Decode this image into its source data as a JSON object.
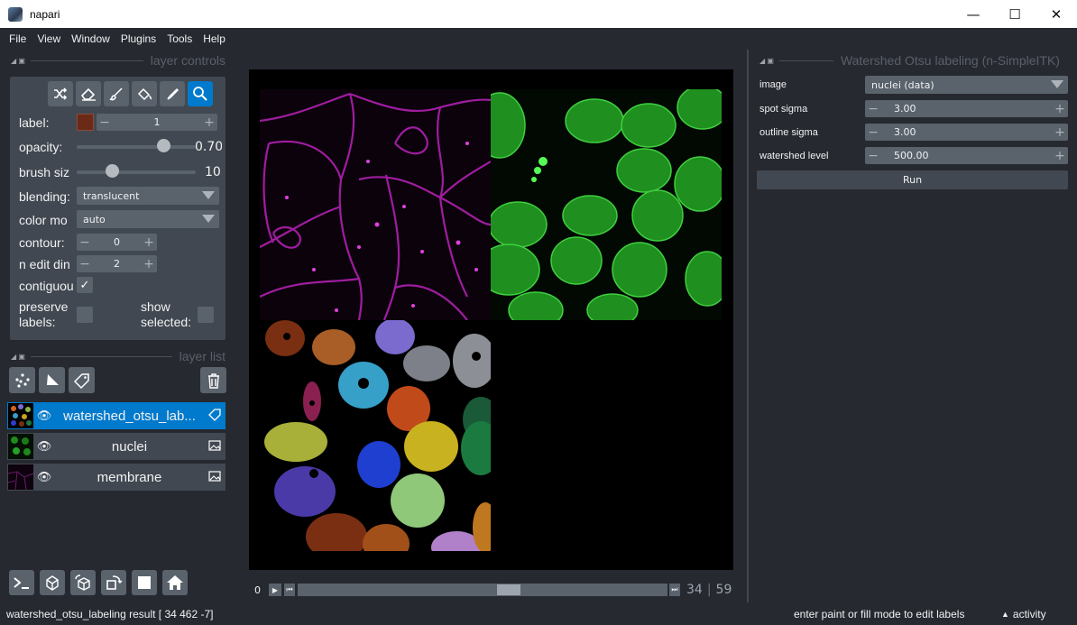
{
  "window": {
    "title": "napari",
    "minimize": "—",
    "maximize": "☐",
    "close": "✕"
  },
  "menu": [
    "File",
    "View",
    "Window",
    "Plugins",
    "Tools",
    "Help"
  ],
  "layer_controls": {
    "header": "layer controls",
    "tools": [
      "shuffle-icon",
      "eraser-icon",
      "paintbrush-icon",
      "fill-icon",
      "picker-icon",
      "zoom-icon"
    ],
    "label": {
      "text": "label:",
      "value": "1",
      "swatch_color": "#6b2a17"
    },
    "opacity": {
      "text": "opacity:",
      "value": "0.70",
      "fraction": 0.7
    },
    "brush_size": {
      "text": "brush siz",
      "value": "10",
      "fraction": 0.27
    },
    "blending": {
      "text": "blending:",
      "value": "translucent"
    },
    "color_mode": {
      "text": "color mo",
      "value": "auto"
    },
    "contour": {
      "text": "contour:",
      "value": "0"
    },
    "n_edit_dim": {
      "text": "n edit din",
      "value": "2"
    },
    "contiguous": {
      "text": "contiguou",
      "checked": true
    },
    "preserve_labels": {
      "text": "preserve labels:"
    },
    "show_selected": {
      "text": "show selected:"
    }
  },
  "layer_list": {
    "header": "layer list",
    "layers": [
      {
        "name": "watershed_otsu_lab...",
        "selected": true,
        "type_icon": "label-icon"
      },
      {
        "name": "nuclei",
        "selected": false,
        "type_icon": "image-icon"
      },
      {
        "name": "membrane",
        "selected": false,
        "type_icon": "image-icon"
      }
    ]
  },
  "dims": {
    "start": "0",
    "current": "34",
    "total": "59"
  },
  "plugin": {
    "header": "Watershed Otsu labeling (n-SimpleITK)",
    "image": {
      "label": "image",
      "value": "nuclei (data)"
    },
    "spot_sigma": {
      "label": "spot sigma",
      "value": "3.00"
    },
    "outline_sigma": {
      "label": "outline sigma",
      "value": "3.00"
    },
    "watershed_level": {
      "label": "watershed level",
      "value": "500.00"
    },
    "run": "Run"
  },
  "status": {
    "left": "watershed_otsu_labeling result [ 34 462  -7]",
    "hint": "enter paint or fill mode to edit labels",
    "activity": "activity"
  },
  "colors": {
    "accent": "#007acc",
    "panel": "#414851",
    "background": "#262930",
    "button": "#5a626c"
  }
}
